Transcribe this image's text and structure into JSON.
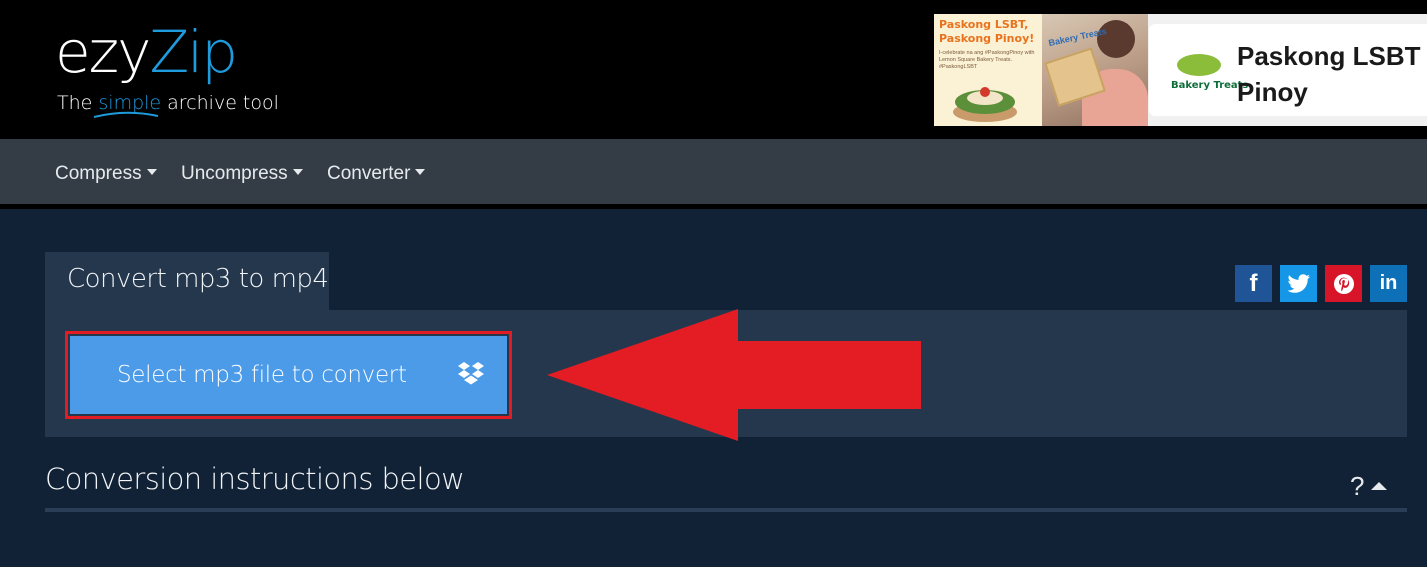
{
  "brand": {
    "logo_part1": "ezy",
    "logo_part2": "Zip",
    "tagline_pre": "The ",
    "tagline_mid": "simple",
    "tagline_post": " archive tool"
  },
  "ad": {
    "headline": "Paskong LSBT, Paskong Pinoy!",
    "subtext": "I-celebrate na ang #PaskongPinoy with Lemon Square Bakery Treats. #PaskongLSBT",
    "photo_brand": "Bakery Treats",
    "card_brand": "Bakery Treats",
    "card_title_line1": "Paskong LSBT",
    "card_title_line2": "Pinoy"
  },
  "nav": {
    "items": [
      {
        "label": "Compress"
      },
      {
        "label": "Uncompress"
      },
      {
        "label": "Converter"
      }
    ]
  },
  "tool": {
    "tab_title": "Convert mp3 to mp4",
    "select_button_label": "Select mp3 file to convert",
    "instructions_heading": "Conversion instructions below",
    "help_glyph": "?"
  },
  "social": {
    "facebook": "f",
    "linkedin": "in"
  },
  "colors": {
    "header_bg": "#000000",
    "nav_bg": "#343d46",
    "page_bg": "#122236",
    "panel_bg": "#25374c",
    "accent": "#1e9bdc",
    "button": "#4c9be9",
    "annotation_red": "#e31b23"
  },
  "icons": [
    "dropbox-icon",
    "facebook-icon",
    "twitter-icon",
    "pinterest-icon",
    "linkedin-icon",
    "caret-down-icon",
    "caret-up-icon",
    "red-arrow-annotation"
  ]
}
